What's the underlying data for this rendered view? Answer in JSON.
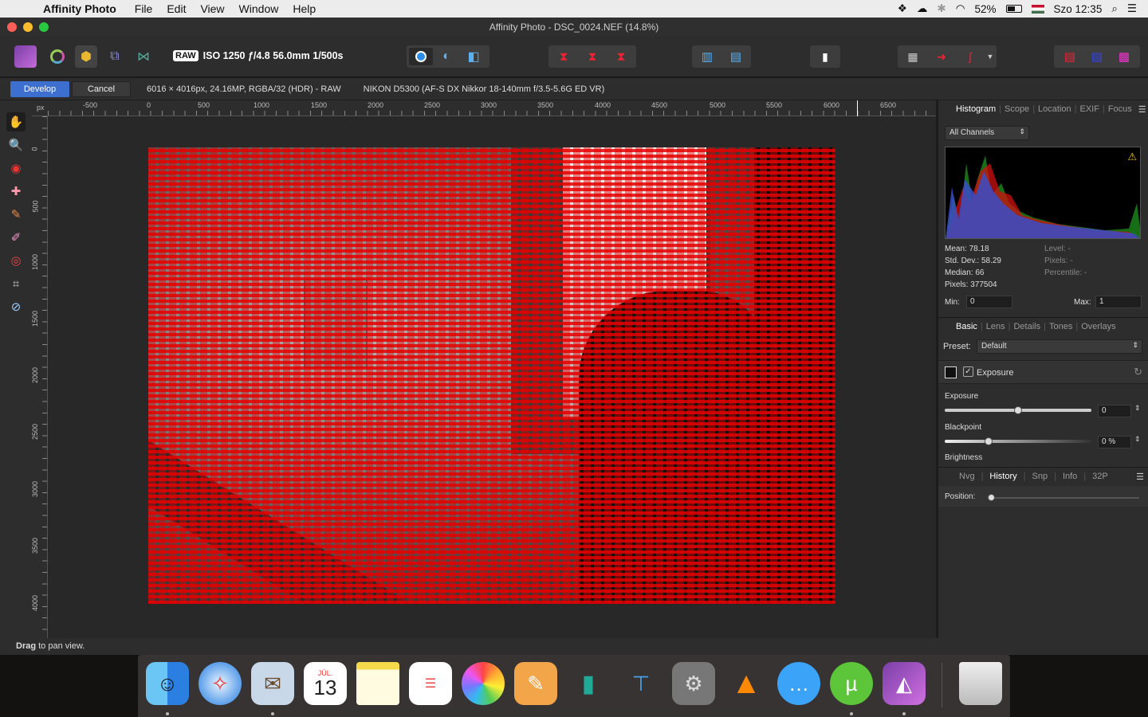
{
  "menubar": {
    "app_name": "Affinity Photo",
    "menus": [
      "File",
      "Edit",
      "View",
      "Window",
      "Help"
    ],
    "battery": "52%",
    "clock": "Szo 12:35"
  },
  "window": {
    "title": "Affinity Photo - DSC_0024.NEF (14.8%)"
  },
  "toolbar": {
    "raw_badge": "RAW",
    "exif_summary": "ISO 1250 ƒ/4.8 56.0mm 1/500s"
  },
  "context": {
    "develop_label": "Develop",
    "cancel_label": "Cancel",
    "image_info": "6016 × 4016px, 24.16MP, RGBA/32 (HDR) - RAW",
    "camera_info": "NIKON D5300 (AF-S DX Nikkor 18-140mm f/3.5-5.6G ED VR)"
  },
  "ruler": {
    "unit": "px",
    "top_labels": [
      "-500",
      "0",
      "500",
      "1000",
      "1500",
      "2000",
      "2500",
      "3000",
      "3500",
      "4000",
      "4500",
      "5000",
      "5500",
      "6000",
      "6500"
    ],
    "left_labels": [
      "0",
      "500",
      "1000",
      "1500",
      "2000",
      "2500",
      "3000",
      "3500",
      "4000"
    ]
  },
  "histogram_panel": {
    "tabs": [
      "Histogram",
      "Scope",
      "Location",
      "EXIF",
      "Focus"
    ],
    "channel": "All Channels",
    "mean": "Mean: 78.18",
    "std_dev": "Std. Dev.: 58.29",
    "median": "Median: 66",
    "pixels": "Pixels: 377504",
    "level": "Level: -",
    "pixels_r": "Pixels: -",
    "percentile": "Percentile: -",
    "min_label": "Min:",
    "min_value": "0",
    "max_label": "Max:",
    "max_value": "1"
  },
  "develop_panel": {
    "tabs": [
      "Basic",
      "Lens",
      "Details",
      "Tones",
      "Overlays"
    ],
    "preset_label": "Preset:",
    "preset_value": "Default",
    "section_title": "Exposure",
    "exposure_label": "Exposure",
    "exposure_value": "0",
    "exposure_position": 0.5,
    "blackpoint_label": "Blackpoint",
    "blackpoint_value": "0 %",
    "blackpoint_position": 0.3,
    "brightness_label": "Brightness"
  },
  "history_panel": {
    "tabs": [
      "Nvg",
      "History",
      "Snp",
      "Info",
      "32P"
    ],
    "position_label": "Position:"
  },
  "status": {
    "bold": "Drag",
    "rest": " to pan view."
  },
  "calendar": {
    "month": "JÚL.",
    "day": "13"
  },
  "colors": {
    "accent": "#3d6fd0",
    "overlay_red": "#e00000"
  }
}
